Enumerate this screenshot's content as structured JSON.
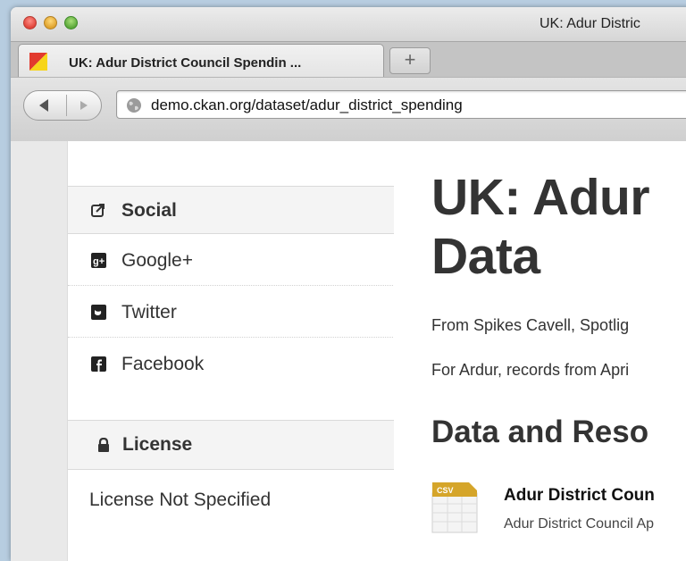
{
  "window": {
    "title": "UK: Adur Distric"
  },
  "tab": {
    "label": "UK: Adur District Council Spendin ...",
    "new_tab_symbol": "+"
  },
  "urlbar": {
    "url": "demo.ckan.org/dataset/adur_district_spending"
  },
  "sidebar": {
    "social_heading": "Social",
    "social_items": [
      {
        "label": "Google+",
        "icon": "google-plus-icon"
      },
      {
        "label": "Twitter",
        "icon": "twitter-icon"
      },
      {
        "label": "Facebook",
        "icon": "facebook-icon"
      }
    ],
    "license_heading": "License",
    "license_value": "License Not Specified"
  },
  "main": {
    "title": "UK: Adur Data",
    "notes_line1": "From Spikes Cavell, Spotlig",
    "notes_line2": "For Ardur, records from Apri",
    "resources_heading": "Data and Reso",
    "resource": {
      "format": "CSV",
      "title": "Adur District Coun",
      "description": "Adur District Council Ap"
    }
  },
  "colors": {
    "text": "#333333",
    "csv_icon": "#d5a52a",
    "heading_bg": "#f4f4f4"
  }
}
